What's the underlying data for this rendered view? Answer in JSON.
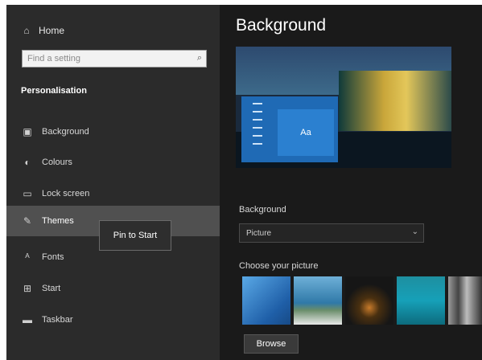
{
  "sidebar": {
    "home_label": "Home",
    "search_placeholder": "Find a setting",
    "section_title": "Personalisation",
    "items": [
      {
        "label": "Background",
        "icon": "picture-icon"
      },
      {
        "label": "Colours",
        "icon": "palette-icon"
      },
      {
        "label": "Lock screen",
        "icon": "lock-screen-icon"
      },
      {
        "label": "Themes",
        "icon": "brush-icon",
        "active": true
      },
      {
        "label": "Fonts",
        "icon": "font-icon"
      },
      {
        "label": "Start",
        "icon": "start-icon"
      },
      {
        "label": "Taskbar",
        "icon": "taskbar-icon"
      }
    ]
  },
  "tooltip": {
    "text": "Pin to Start"
  },
  "main": {
    "title": "Background",
    "preview": {
      "sample_text": "Aa"
    },
    "background_label": "Background",
    "background_value": "Picture",
    "choose_label": "Choose your picture",
    "browse_label": "Browse"
  },
  "colors": {
    "sidebar_bg": "#2b2b2b",
    "content_bg": "#1a1a1a",
    "active_item": "#505050",
    "accent": "#2b80d0"
  }
}
